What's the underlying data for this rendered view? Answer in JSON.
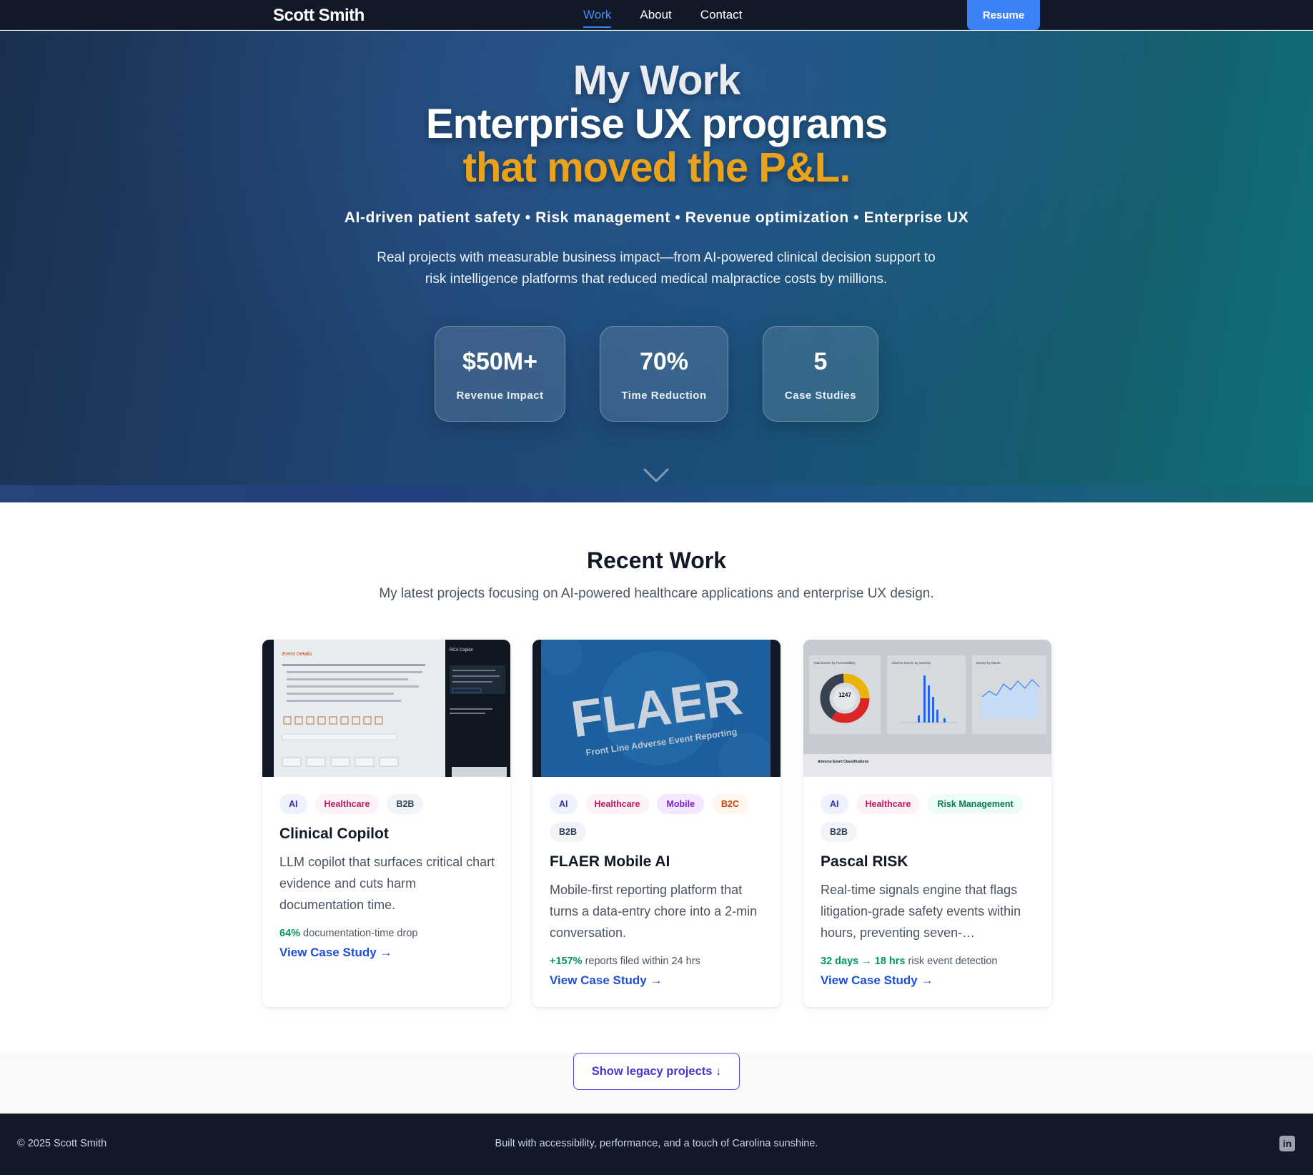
{
  "nav": {
    "brand": "Scott Smith",
    "links": [
      {
        "label": "Work",
        "active": true
      },
      {
        "label": "About",
        "active": false
      },
      {
        "label": "Contact",
        "active": false
      }
    ],
    "resume_label": "Resume"
  },
  "hero": {
    "title_line1": "My Work",
    "title_line2": "Enterprise UX programs",
    "title_line3": "that moved the P&L.",
    "tags_line": "AI-driven patient safety • Risk management • Revenue optimization • Enterprise UX",
    "description": "Real projects with measurable business impact—from AI-powered clinical decision support to risk intelligence platforms that reduced medical malpractice costs by millions.",
    "stats": [
      {
        "value": "$50M+",
        "label": "Revenue Impact"
      },
      {
        "value": "70%",
        "label": "Time Reduction"
      },
      {
        "value": "5",
        "label": "Case Studies"
      }
    ],
    "scroll_icon": "chevron-down-icon"
  },
  "recent": {
    "title": "Recent Work",
    "subtitle": "My latest projects focusing on AI-powered healthcare applications and enterprise UX design.",
    "cards": [
      {
        "tags": [
          "AI",
          "Healthcare",
          "B2B"
        ],
        "title": "Clinical Copilot",
        "description": "LLM copilot that surfaces critical chart evidence and cuts harm documentation time.",
        "metric_value": "64%",
        "metric_text": " documentation-time drop",
        "cta": "View Case Study →",
        "thumb": {
          "heading": "Event Details",
          "side": "RCA Copilot"
        }
      },
      {
        "tags": [
          "AI",
          "Healthcare",
          "Mobile",
          "B2C",
          "B2B"
        ],
        "title": "FLAER Mobile AI",
        "description": "Mobile-first reporting platform that turns a data-entry chore into a 2-min conversation.",
        "metric_value": "+157%",
        "metric_text": " reports filed within 24 hrs",
        "cta": "View Case Study →",
        "thumb": {
          "logo": "FLAER",
          "tagline": "Front Line Adverse Event Reporting"
        }
      },
      {
        "tags": [
          "AI",
          "Healthcare",
          "Risk Management",
          "B2B"
        ],
        "title": "Pascal RISK",
        "description": "Real-time signals engine that flags litigation-grade safety events within hours, preventing seven-…",
        "metric_value": "32 days → 18 hrs",
        "metric_text": " risk event detection",
        "cta": "View Case Study →",
        "thumb": {
          "panel1": "Total Events by Preventability",
          "donut_center": "1247",
          "panel2": "Adverse Events by Severity",
          "panel3": "Events by Month",
          "footer": "Adverse Event Classifications"
        }
      }
    ]
  },
  "legacy_button": "Show legacy projects ↓",
  "footer": {
    "copyright": "© 2025 Scott Smith",
    "built": "Built with accessibility, performance, and a touch of Carolina sunshine.",
    "social_icon": "linkedin-icon"
  },
  "colors": {
    "accent": "#3b82f6",
    "highlight": "#eaa21a",
    "metric_green": "#059669",
    "footer_bg": "#111827"
  }
}
